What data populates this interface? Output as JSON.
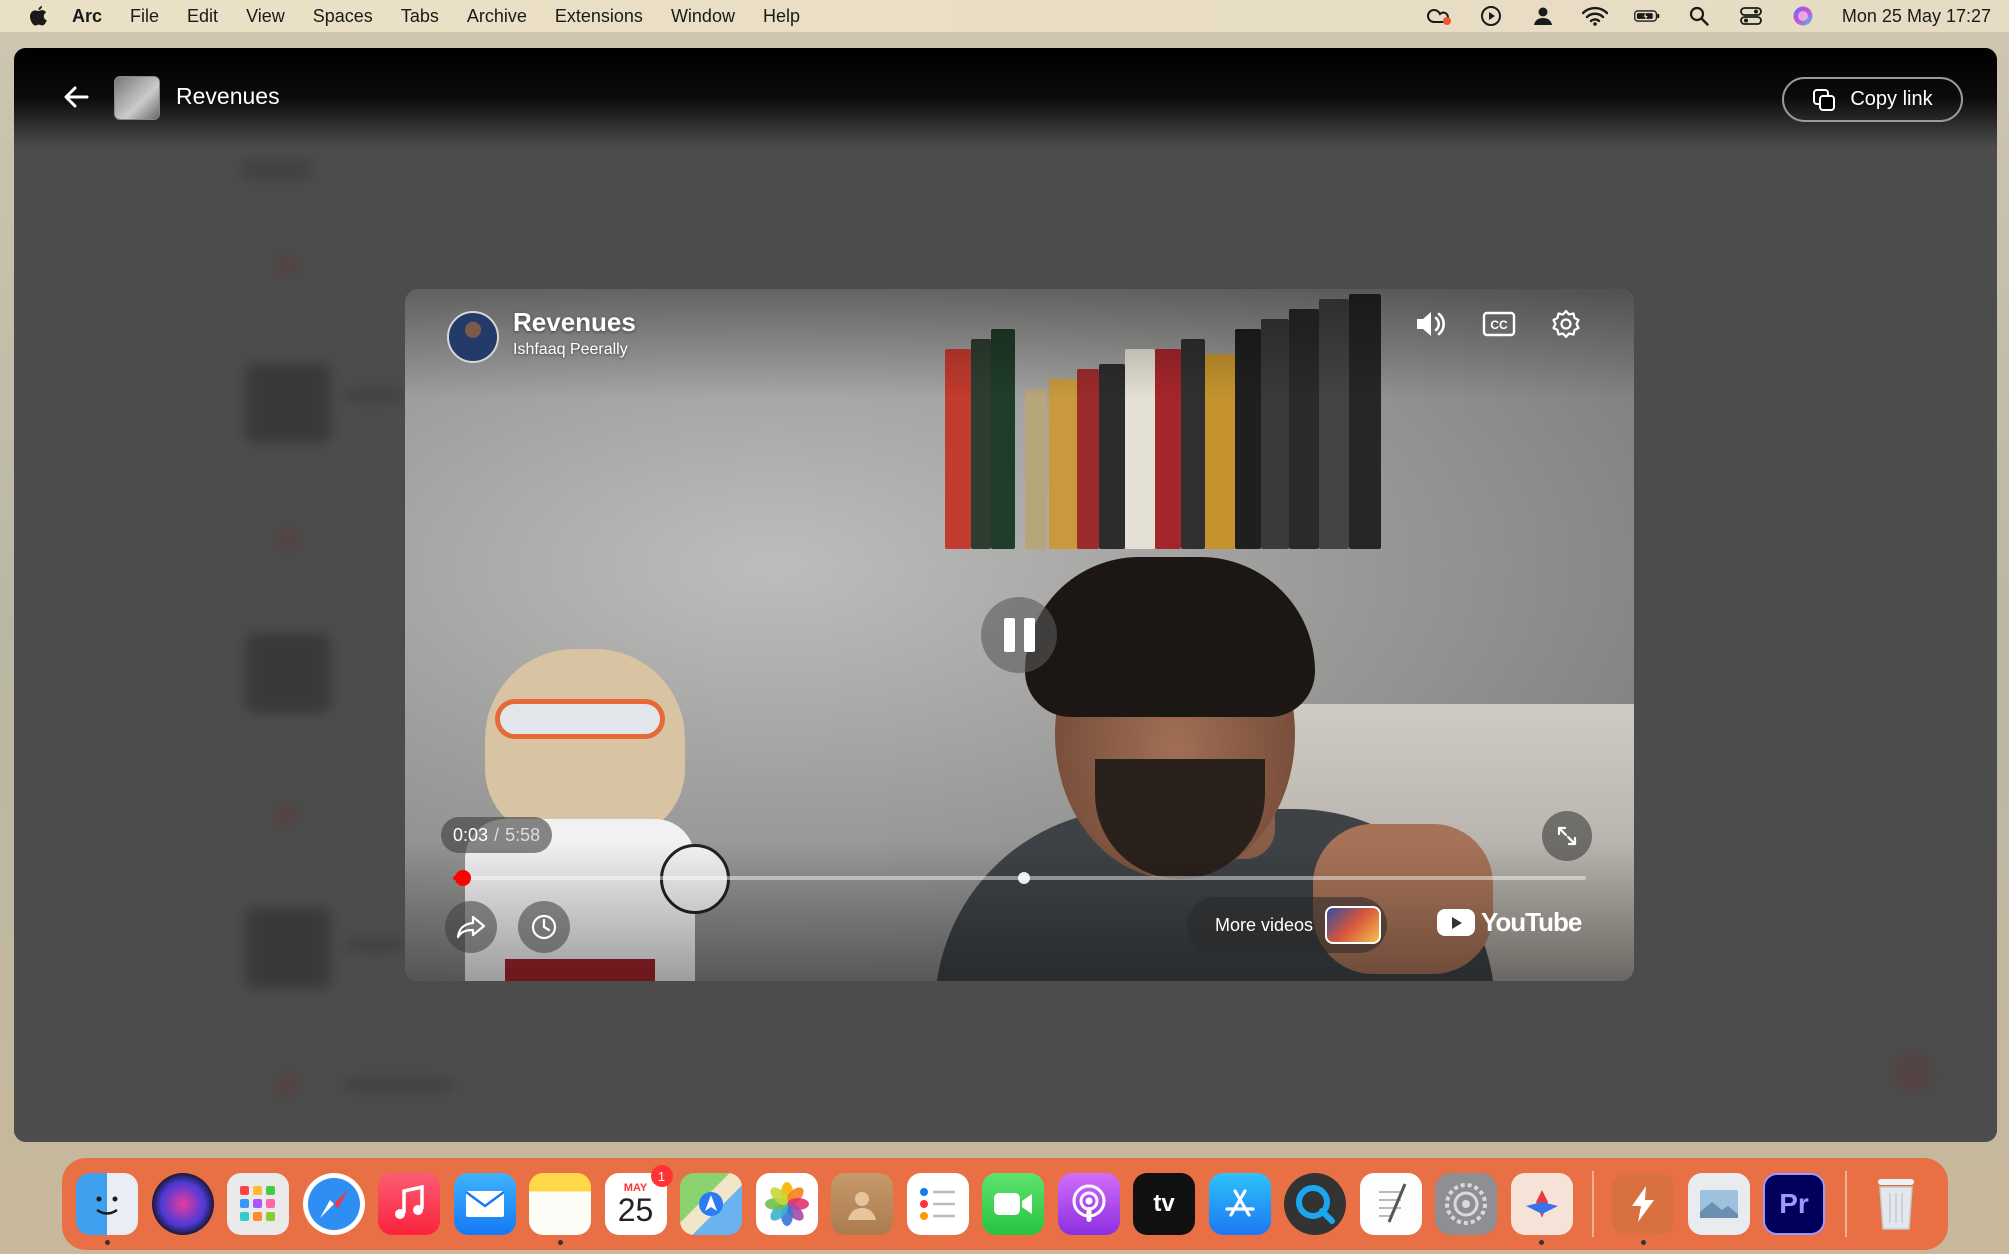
{
  "menubar": {
    "app_name": "Arc",
    "items": [
      "File",
      "Edit",
      "View",
      "Spaces",
      "Tabs",
      "Archive",
      "Extensions",
      "Window",
      "Help"
    ],
    "status_icons": [
      "creative-cloud-icon",
      "play-circle-icon",
      "user-icon",
      "wifi-icon",
      "battery-icon",
      "search-icon",
      "control-center-icon",
      "siri-icon"
    ],
    "clock": "Mon 25 May  17:27"
  },
  "window": {
    "page_title": "Revenues",
    "copy_link_label": "Copy link"
  },
  "player": {
    "title": "Revenues",
    "channel": "Ishfaaq Peerally",
    "time_current": "0:03",
    "time_separator": "/",
    "time_total": "5:58",
    "progress_fraction": 0.009,
    "buffered_fraction": 0.504,
    "more_videos_label": "More videos",
    "youtube_label": "YouTube"
  },
  "dock": {
    "calendar_month": "MAY",
    "calendar_day": "25",
    "calendar_badge": "1",
    "apps": [
      "finder",
      "siri",
      "launchpad",
      "safari",
      "music",
      "mail",
      "notes",
      "calendar",
      "maps",
      "photos",
      "contacts",
      "reminders",
      "facetime",
      "podcasts",
      "apple-tv",
      "app-store",
      "quicktime",
      "textedit",
      "system-preferences",
      "creative-cloud",
      "spark",
      "preview",
      "premiere-pro",
      "trash"
    ],
    "premiere_label": "Pr",
    "tv_label": "tv"
  }
}
